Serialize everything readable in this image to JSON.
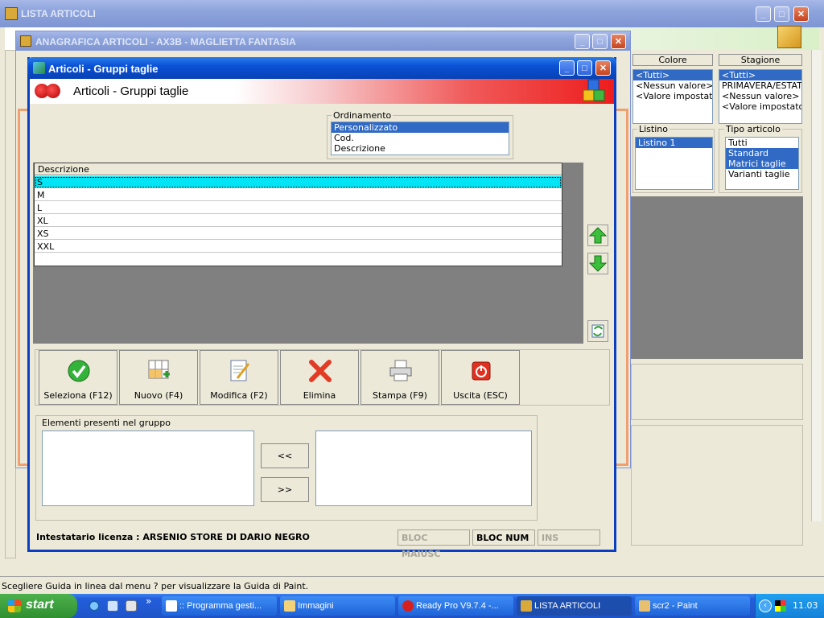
{
  "lista": {
    "title": "LISTA ARTICOLI"
  },
  "anagrafica": {
    "title": "ANAGRAFICA ARTICOLI - AX3B - MAGLIETTA FANTASIA"
  },
  "dialog": {
    "title": "Articoli - Gruppi taglie",
    "banner_title": "Articoli - Gruppi taglie",
    "ordinamento": {
      "label": "Ordinamento",
      "items": [
        "Personalizzato",
        "Cod.",
        "Descrizione"
      ],
      "selected": 0
    },
    "grid": {
      "header": "Descrizione",
      "rows": [
        "S",
        "M",
        "L",
        "XL",
        "XS",
        "XXL"
      ],
      "selected": 0
    },
    "toolbar": {
      "seleziona": "Seleziona (F12)",
      "nuovo": "Nuovo (F4)",
      "modifica": "Modifica (F2)",
      "elimina": "Elimina",
      "stampa": "Stampa (F9)",
      "uscita": "Uscita (ESC)"
    },
    "elementi": {
      "label": "Elementi presenti nel gruppo",
      "left_btn": "<<",
      "right_btn": ">>"
    },
    "status": {
      "licenza": "Intestatario licenza : ARSENIO STORE DI DARIO NEGRO",
      "maiusc": "BLOC MAIUSC",
      "num": "BLOC NUM",
      "ins": "INS"
    }
  },
  "filters": {
    "colore": {
      "label": "Colore",
      "items": [
        "<Tutti>",
        "<Nessun valore>",
        "<Valore impostato>"
      ]
    },
    "stagione": {
      "label": "Stagione",
      "items": [
        "<Tutti>",
        "PRIMAVERA/ESTAT",
        "<Nessun valore>",
        "<Valore impostato>"
      ]
    },
    "listino": {
      "label": "Listino",
      "items": [
        "Listino 1"
      ]
    },
    "tipo": {
      "label": "Tipo articolo",
      "items": [
        "Tutti",
        "Standard",
        "Matrici taglie",
        "Varianti taglie"
      ]
    }
  },
  "paint_status": "Scegliere Guida in linea dal menu ? per visualizzare la Guida di Paint.",
  "taskbar": {
    "start": "start",
    "quick_more": "»",
    "tasks": [
      ":: Programma gesti...",
      "Immagini",
      "Ready Pro V9.7.4 -...",
      "LISTA ARTICOLI",
      "scr2 - Paint"
    ],
    "clock": "11.03"
  },
  "colors": {
    "xp_blue": "#0a52d6",
    "selection": "#316ac5",
    "grid_selected": "#00e5f5"
  }
}
